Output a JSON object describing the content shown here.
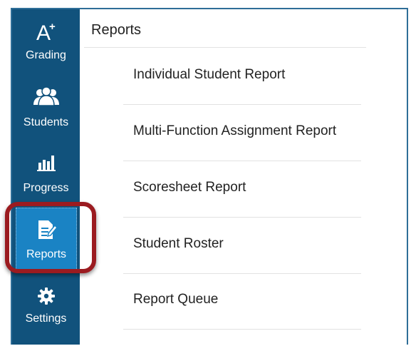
{
  "sidebar": {
    "items": [
      {
        "id": "grading",
        "label": "Grading",
        "icon": "a-plus-icon"
      },
      {
        "id": "students",
        "label": "Students",
        "icon": "students-icon"
      },
      {
        "id": "progress",
        "label": "Progress",
        "icon": "progress-chart-icon"
      },
      {
        "id": "reports",
        "label": "Reports",
        "icon": "report-document-icon",
        "active": true
      },
      {
        "id": "settings",
        "label": "Settings",
        "icon": "gear-icon"
      }
    ]
  },
  "main": {
    "title": "Reports",
    "reports": [
      {
        "label": "Individual Student Report"
      },
      {
        "label": "Multi-Function Assignment Report"
      },
      {
        "label": "Scoresheet Report"
      },
      {
        "label": "Student Roster"
      },
      {
        "label": "Report Queue"
      }
    ]
  },
  "colors": {
    "sidebar_bg": "#11527c",
    "active_bg": "#1a83c4",
    "highlight_border": "#9b1b20",
    "frame_border": "#2f6e98"
  }
}
